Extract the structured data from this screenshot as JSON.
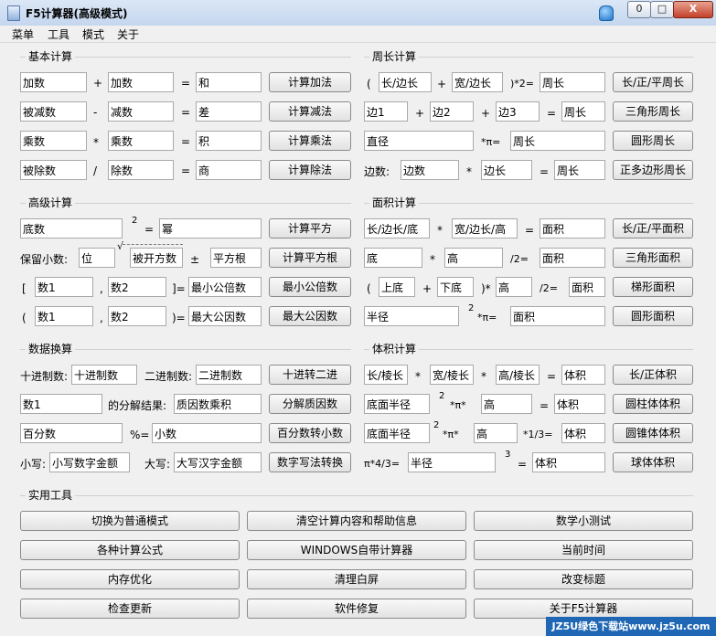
{
  "window": {
    "title": "F5计算器(高级模式)",
    "min_label": "0",
    "max_label": "□",
    "close_label": "X"
  },
  "menu": [
    "菜单",
    "工具",
    "模式",
    "关于"
  ],
  "basic": {
    "title": "基本计算",
    "rows": [
      {
        "a": "加数",
        "op": "+",
        "b": "加数",
        "eq": "=",
        "r": "和",
        "btn": "计算加法"
      },
      {
        "a": "被减数",
        "op": "-",
        "b": "减数",
        "eq": "=",
        "r": "差",
        "btn": "计算减法"
      },
      {
        "a": "乘数",
        "op": "*",
        "b": "乘数",
        "eq": "=",
        "r": "积",
        "btn": "计算乘法"
      },
      {
        "a": "被除数",
        "op": "/",
        "b": "除数",
        "eq": "=",
        "r": "商",
        "btn": "计算除法"
      }
    ]
  },
  "advanced": {
    "title": "高级计算",
    "power": {
      "base": "底数",
      "exp": "2",
      "eq": "=",
      "result": "幂",
      "btn": "计算平方"
    },
    "sqrt": {
      "label": "保留小数:",
      "digits": "位",
      "radical": "√",
      "radicand": "被开方数",
      "pm": "±",
      "result": "平方根",
      "btn": "计算平方根"
    },
    "lcm": {
      "open": "[",
      "a": "数1",
      "comma": ",",
      "b": "数2",
      "close": "]=",
      "result": "最小公倍数",
      "btn": "最小公倍数"
    },
    "gcd": {
      "open": "(",
      "a": "数1",
      "comma": ",",
      "b": "数2",
      "close": ")=",
      "result": "最大公因数",
      "btn": "最大公因数"
    }
  },
  "convert": {
    "title": "数据换算",
    "base": {
      "dec_label": "十进制数:",
      "dec": "十进制数",
      "bin_label": "二进制数:",
      "bin": "二进制数",
      "btn": "十进转二进"
    },
    "factor": {
      "num": "数1",
      "label": "的分解结果:",
      "result": "质因数乘积",
      "btn": "分解质因数"
    },
    "percent": {
      "pct": "百分数",
      "op": "%=",
      "dec": "小数",
      "btn": "百分数转小数"
    },
    "money": {
      "lower_label": "小写:",
      "lower": "小写数字金额",
      "upper_label": "大写:",
      "upper": "大写汉字金额",
      "btn": "数字写法转换"
    }
  },
  "perimeter": {
    "title": "周长计算",
    "rect": {
      "open": "(",
      "a": "长/边长",
      "plus": "+",
      "b": "宽/边长",
      "close": ")*2=",
      "result": "周长",
      "btn": "长/正/平周长"
    },
    "tri": {
      "a": "边1",
      "p1": "+",
      "b": "边2",
      "p2": "+",
      "c": "边3",
      "eq": "=",
      "result": "周长",
      "btn": "三角形周长"
    },
    "circle": {
      "d": "直径",
      "op": "*π=",
      "result": "周长",
      "btn": "圆形周长"
    },
    "poly": {
      "label": "边数:",
      "n": "边数",
      "op": "*",
      "side": "边长",
      "eq": "=",
      "result": "周长",
      "btn": "正多边形周长"
    }
  },
  "area": {
    "title": "面积计算",
    "rect": {
      "a": "长/边长/底",
      "op": "*",
      "b": "宽/边长/高",
      "eq": "=",
      "result": "面积",
      "btn": "长/正/平面积"
    },
    "tri": {
      "base": "底",
      "op": "*",
      "h": "高",
      "div": "/2=",
      "result": "面积",
      "btn": "三角形面积"
    },
    "trap": {
      "open": "(",
      "top": "上底",
      "plus": "+",
      "bottom": "下底",
      "close": ")*",
      "h": "高",
      "div": "/2=",
      "result": "面积",
      "btn": "梯形面积"
    },
    "circle": {
      "r": "半径",
      "exp": "2",
      "op": "*π=",
      "result": "面积",
      "btn": "圆形面积"
    }
  },
  "volume": {
    "title": "体积计算",
    "cuboid": {
      "a": "长/棱长",
      "op1": "*",
      "b": "宽/棱长",
      "op2": "*",
      "c": "高/棱长",
      "eq": "=",
      "result": "体积",
      "btn": "长/正体积"
    },
    "cyl": {
      "r": "底面半径",
      "exp": "2",
      "op": "*π*",
      "h": "高",
      "eq": "=",
      "result": "体积",
      "btn": "圆柱体体积"
    },
    "cone": {
      "r": "底面半径",
      "exp": "2",
      "op": "*π*",
      "h": "高",
      "div": "*1/3=",
      "result": "体积",
      "btn": "圆锥体体积"
    },
    "sphere": {
      "op": "π*4/3=",
      "r": "半径",
      "exp": "3",
      "eq": "=",
      "result": "体积",
      "btn": "球体体积"
    }
  },
  "tools": {
    "title": "实用工具",
    "buttons": [
      "切换为普通模式",
      "清空计算内容和帮助信息",
      "数学小测试",
      "各种计算公式",
      "WINDOWS自带计算器",
      "当前时间",
      "内存优化",
      "清理白屏",
      "改变标题",
      "检查更新",
      "软件修复",
      "关于F5计算器"
    ]
  },
  "watermark": "JZ5U绿色下载站www.jz5u.com"
}
